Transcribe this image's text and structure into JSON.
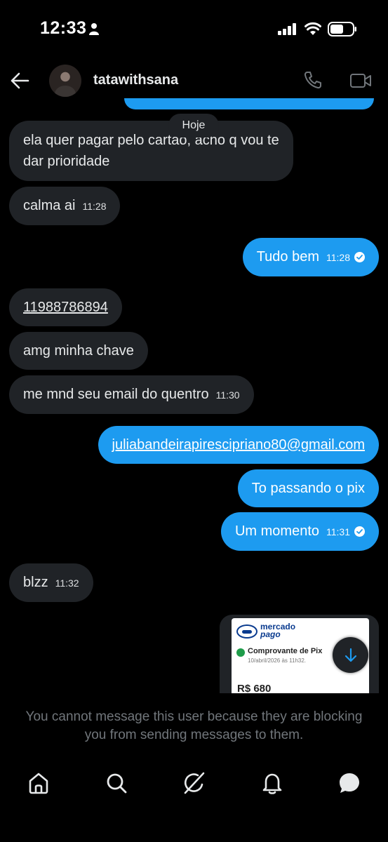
{
  "status_bar": {
    "time": "12:33"
  },
  "header": {
    "username": "tatawithsana"
  },
  "chat": {
    "date_divider": "Hoje",
    "messages": [
      {
        "direction": "in",
        "text_line1": "ela quer pagar pelo cartao, acho q vou te",
        "text_line2": "dar prioridade"
      },
      {
        "direction": "in",
        "text": "calma ai",
        "time": "11:28"
      },
      {
        "direction": "out",
        "text": "Tudo bem",
        "time": "11:28"
      },
      {
        "direction": "in",
        "text": "11988786894"
      },
      {
        "direction": "in",
        "text": "amg minha chave"
      },
      {
        "direction": "in",
        "text": "me mnd seu email do quentro",
        "time": "11:30"
      },
      {
        "direction": "out",
        "text": "juliabandeirapirescipriano80@gmail.com"
      },
      {
        "direction": "out",
        "text": "To passando o pix"
      },
      {
        "direction": "out",
        "text": "Um momento",
        "time": "11:31"
      },
      {
        "direction": "in",
        "text": "blzz",
        "time": "11:32"
      }
    ],
    "receipt": {
      "brand_line1": "mercado",
      "brand_line2": "pago",
      "title": "Comprovante de Pix",
      "date": "10/abril/2026 às 11h32.",
      "amount": "R$ 680"
    }
  },
  "blocked_notice": "You cannot message this user because they are blocking you from sending messages to them.",
  "colors": {
    "accent": "#1d9bf0",
    "incoming_bubble": "#202327",
    "background": "#000000",
    "muted_text": "#71767b"
  },
  "nav": {
    "icons": [
      "home-icon",
      "search-icon",
      "grok-icon",
      "notifications-icon",
      "messages-icon"
    ]
  }
}
